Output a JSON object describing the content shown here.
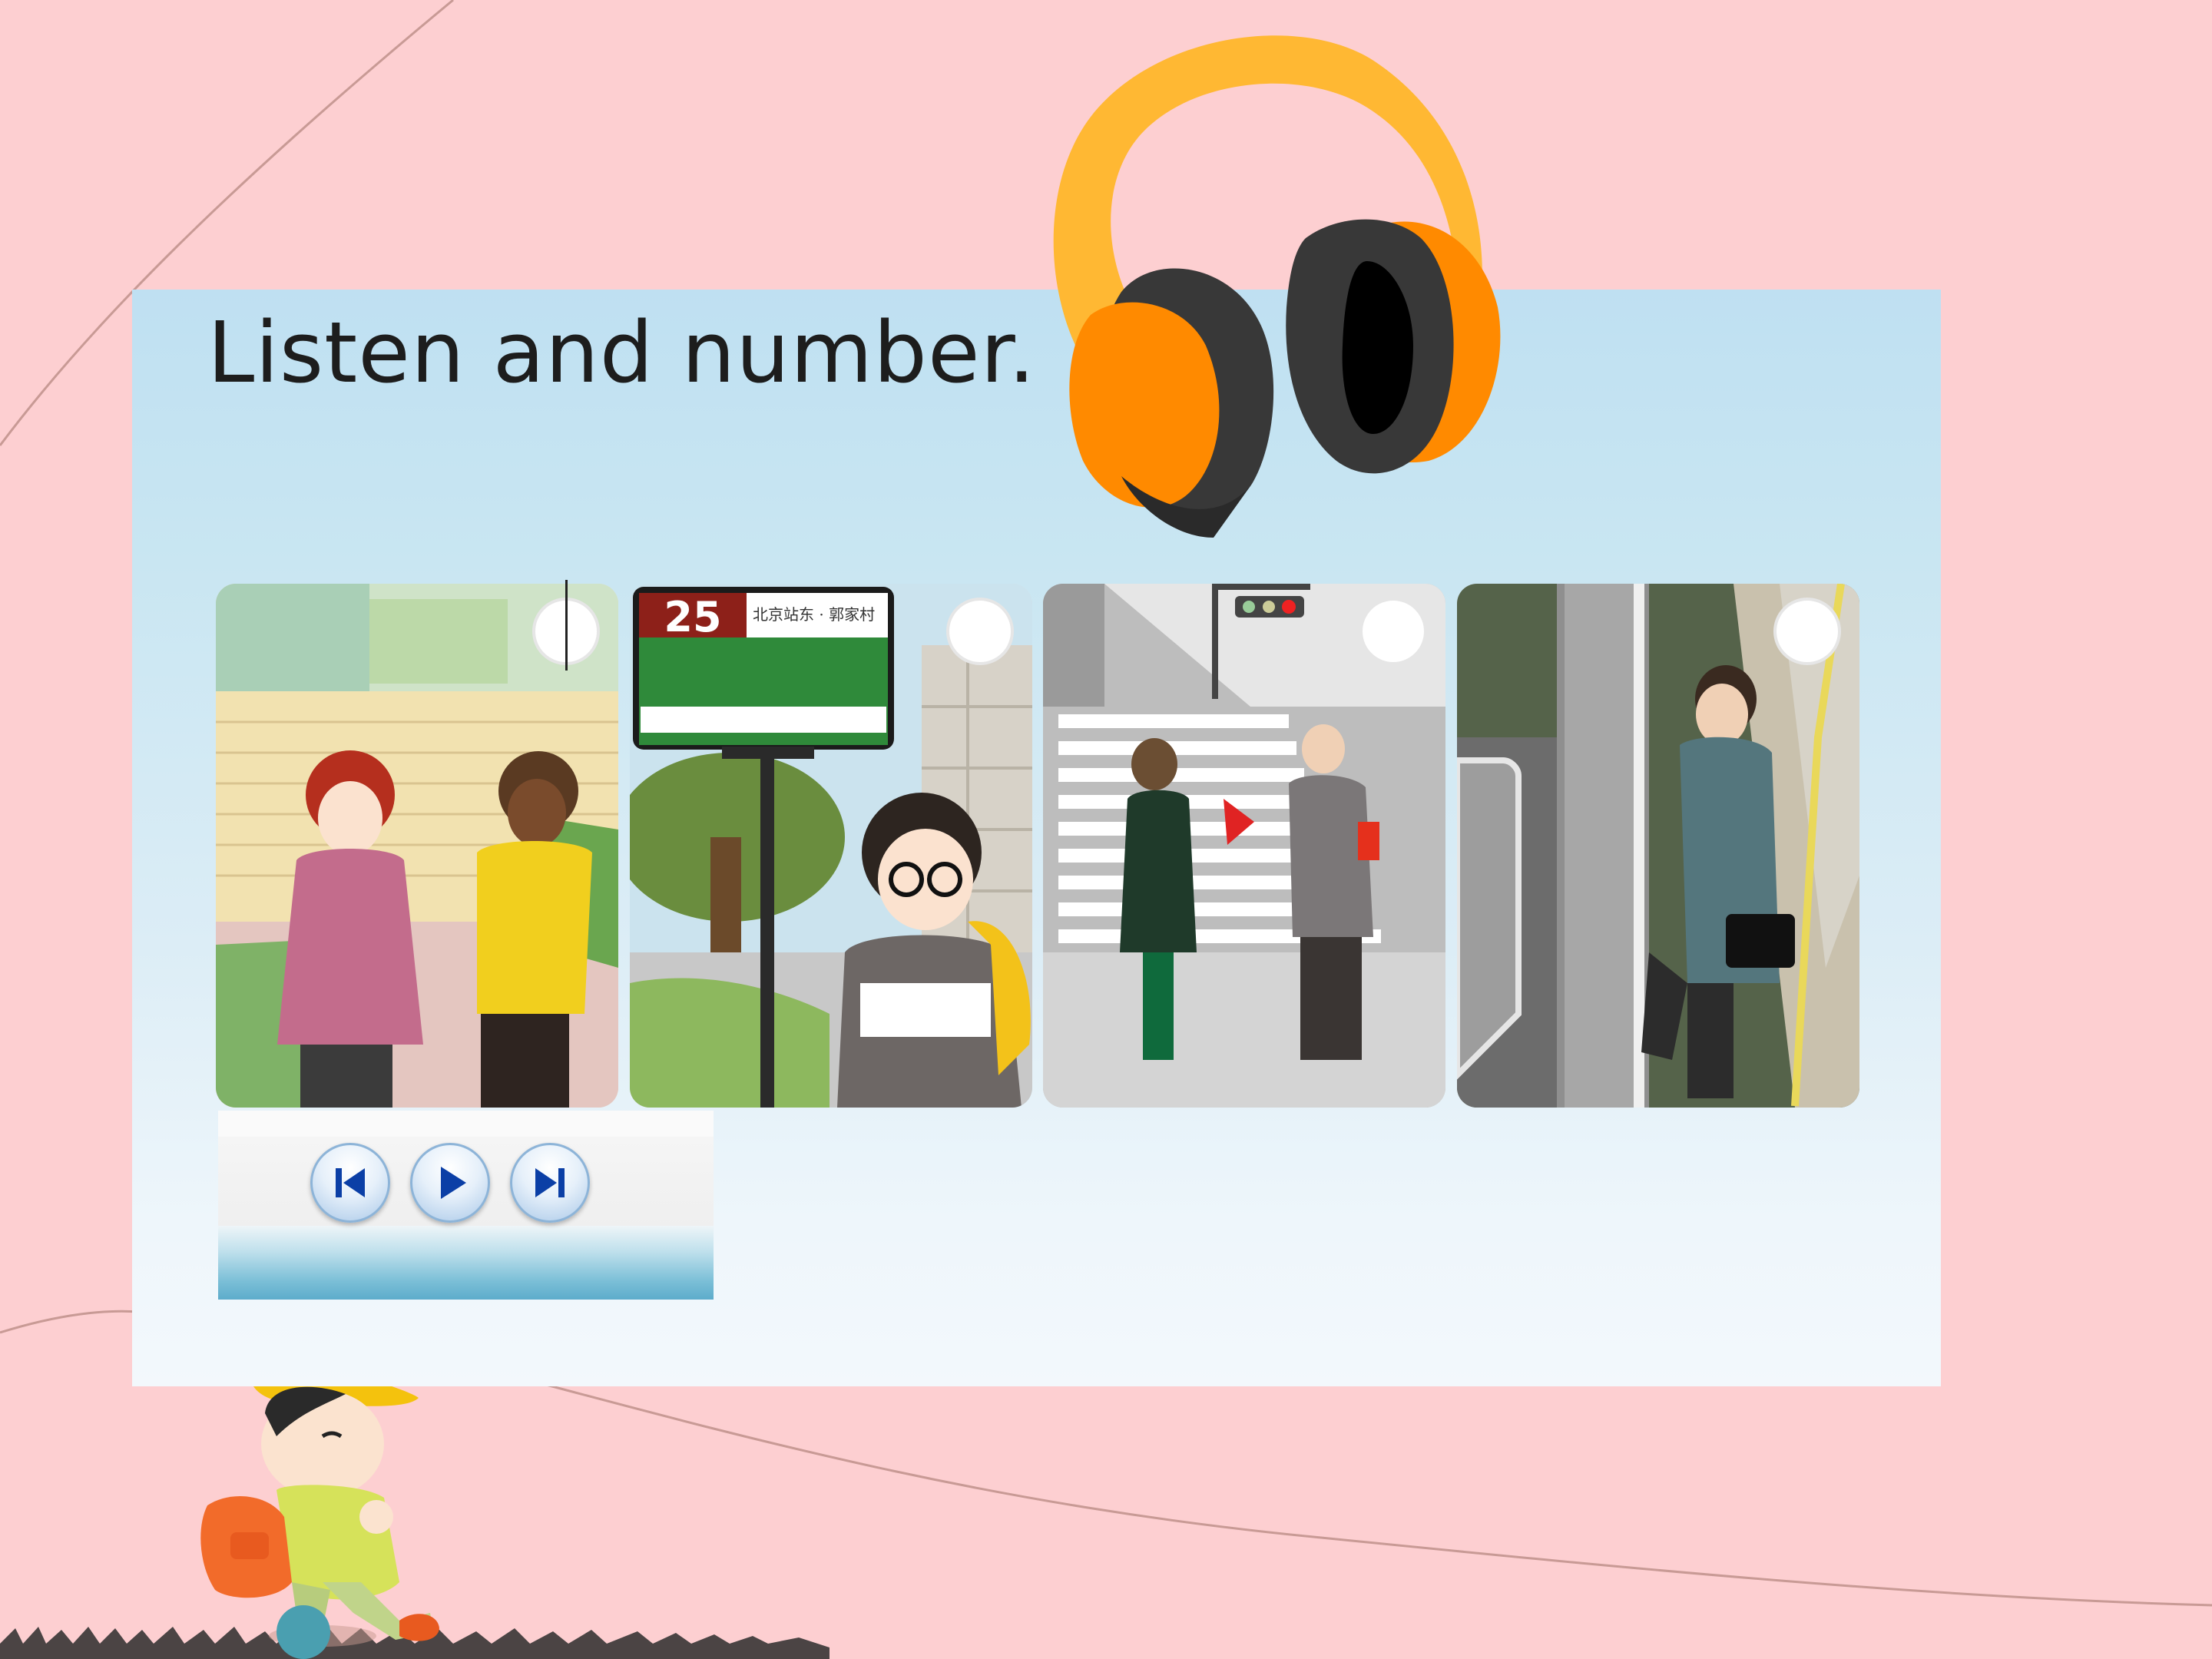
{
  "title": "Listen and number.",
  "cards": [
    {
      "number": ""
    },
    {
      "number": "",
      "bus_sign_route": "25",
      "bus_sign_stops": "北京站东 · 郭家村"
    },
    {
      "number": ""
    },
    {
      "number": ""
    }
  ],
  "player": {
    "buttons": [
      "previous",
      "play",
      "next"
    ]
  },
  "colors": {
    "background": "#fdcfd1",
    "panel_top": "#bfe0f2",
    "headphone_band": "#ffb833",
    "headphone_cup": "#ff8a00",
    "player_button_icon": "#0b3fa6"
  },
  "icons": [
    "headphones-icon",
    "skip-previous-icon",
    "play-icon",
    "skip-next-icon"
  ]
}
